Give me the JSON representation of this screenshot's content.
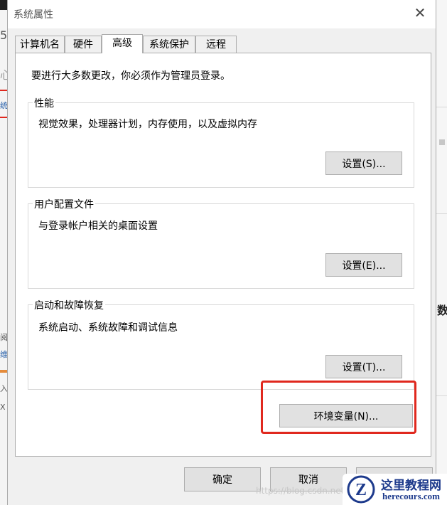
{
  "background_window": {
    "left_fragments": [
      "5",
      "心",
      "统",
      "阅",
      "维",
      "入",
      "X"
    ],
    "right_fragment": "数"
  },
  "dialog": {
    "title": "系统属性",
    "close_glyph": "✕",
    "tabs": [
      {
        "label": "计算机名",
        "active": false
      },
      {
        "label": "硬件",
        "active": false
      },
      {
        "label": "高级",
        "active": true
      },
      {
        "label": "系统保护",
        "active": false
      },
      {
        "label": "远程",
        "active": false
      }
    ],
    "admin_note": "要进行大多数更改，你必须作为管理员登录。",
    "groups": {
      "performance": {
        "title": "性能",
        "description": "视觉效果，处理器计划，内存使用，以及虚拟内存",
        "button": "设置(S)..."
      },
      "user_profiles": {
        "title": "用户配置文件",
        "description": "与登录帐户相关的桌面设置",
        "button": "设置(E)..."
      },
      "startup_recovery": {
        "title": "启动和故障恢复",
        "description": "系统启动、系统故障和调试信息",
        "button": "设置(T)..."
      }
    },
    "env_button": "环境变量(N)...",
    "footer": {
      "ok": "确定",
      "cancel": "取消"
    }
  },
  "annotation": {
    "highlight_color": "#e0281e"
  },
  "watermark": "https://blog.csdn.net",
  "logo": {
    "letter": "Z",
    "cn": "这里教程网",
    "en": "herecours.com"
  }
}
